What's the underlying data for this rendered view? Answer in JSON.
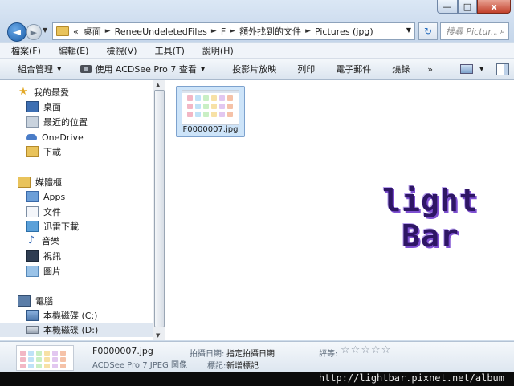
{
  "window": {
    "caption_buttons": {
      "min": "—",
      "max": "□",
      "close": "x"
    }
  },
  "address": {
    "back_glyph": "◄",
    "fwd_glyph": "►",
    "overflow": "«",
    "crumbs": [
      "桌面",
      "ReneeUndeletedFiles",
      "F",
      "額外找到的文件",
      "Pictures (jpg)"
    ],
    "separator": "►",
    "dropdown": "▼",
    "refresh_glyph": "↻"
  },
  "search": {
    "placeholder": "搜尋 Pictur...",
    "icon": "search-icon",
    "glyph": "⌕"
  },
  "menu": {
    "items": [
      "檔案(F)",
      "編輯(E)",
      "檢視(V)",
      "工具(T)",
      "說明(H)"
    ]
  },
  "toolbar": {
    "organize": "組合管理",
    "open_with": "使用 ACDSee Pro 7 查看",
    "slideshow": "投影片放映",
    "print": "列印",
    "email": "電子郵件",
    "burn": "燒錄",
    "more": "»",
    "dropdown_glyph": "▼",
    "help_glyph": "?"
  },
  "navpane": {
    "favorites": {
      "header": "我的最愛",
      "items": [
        "桌面",
        "最近的位置",
        "OneDrive",
        "下載"
      ]
    },
    "libraries": {
      "header": "媒體櫃",
      "items": [
        "Apps",
        "文件",
        "迅雷下載",
        "音樂",
        "視訊",
        "圖片"
      ]
    },
    "computer": {
      "header": "電腦",
      "items": [
        "本機磁碟 (C:)",
        "本機磁碟 (D:)"
      ]
    },
    "star_glyph": "★",
    "music_glyph": "♪"
  },
  "content": {
    "files": [
      {
        "name": "F0000007.jpg",
        "selected": true
      }
    ],
    "watermark": {
      "line1": "light",
      "line2": "Bar",
      "color": "#2e1665"
    }
  },
  "details": {
    "file_name": "F0000007.jpg",
    "file_type": "ACDSee Pro 7 JPEG 圖像",
    "date_taken_label": "拍攝日期:",
    "date_taken_value": "指定拍攝日期",
    "tags_label": "標記:",
    "tags_value": "新增標記",
    "rating_label": "評等:",
    "rating": 0,
    "rating_max": 5,
    "star_glyph": "☆"
  },
  "banner": {
    "url": "http://lightbar.pixnet.net/album"
  },
  "colors": {
    "selection": "#cde4f9",
    "selection_border": "#7da2ce",
    "close_button": "#c2412b"
  }
}
